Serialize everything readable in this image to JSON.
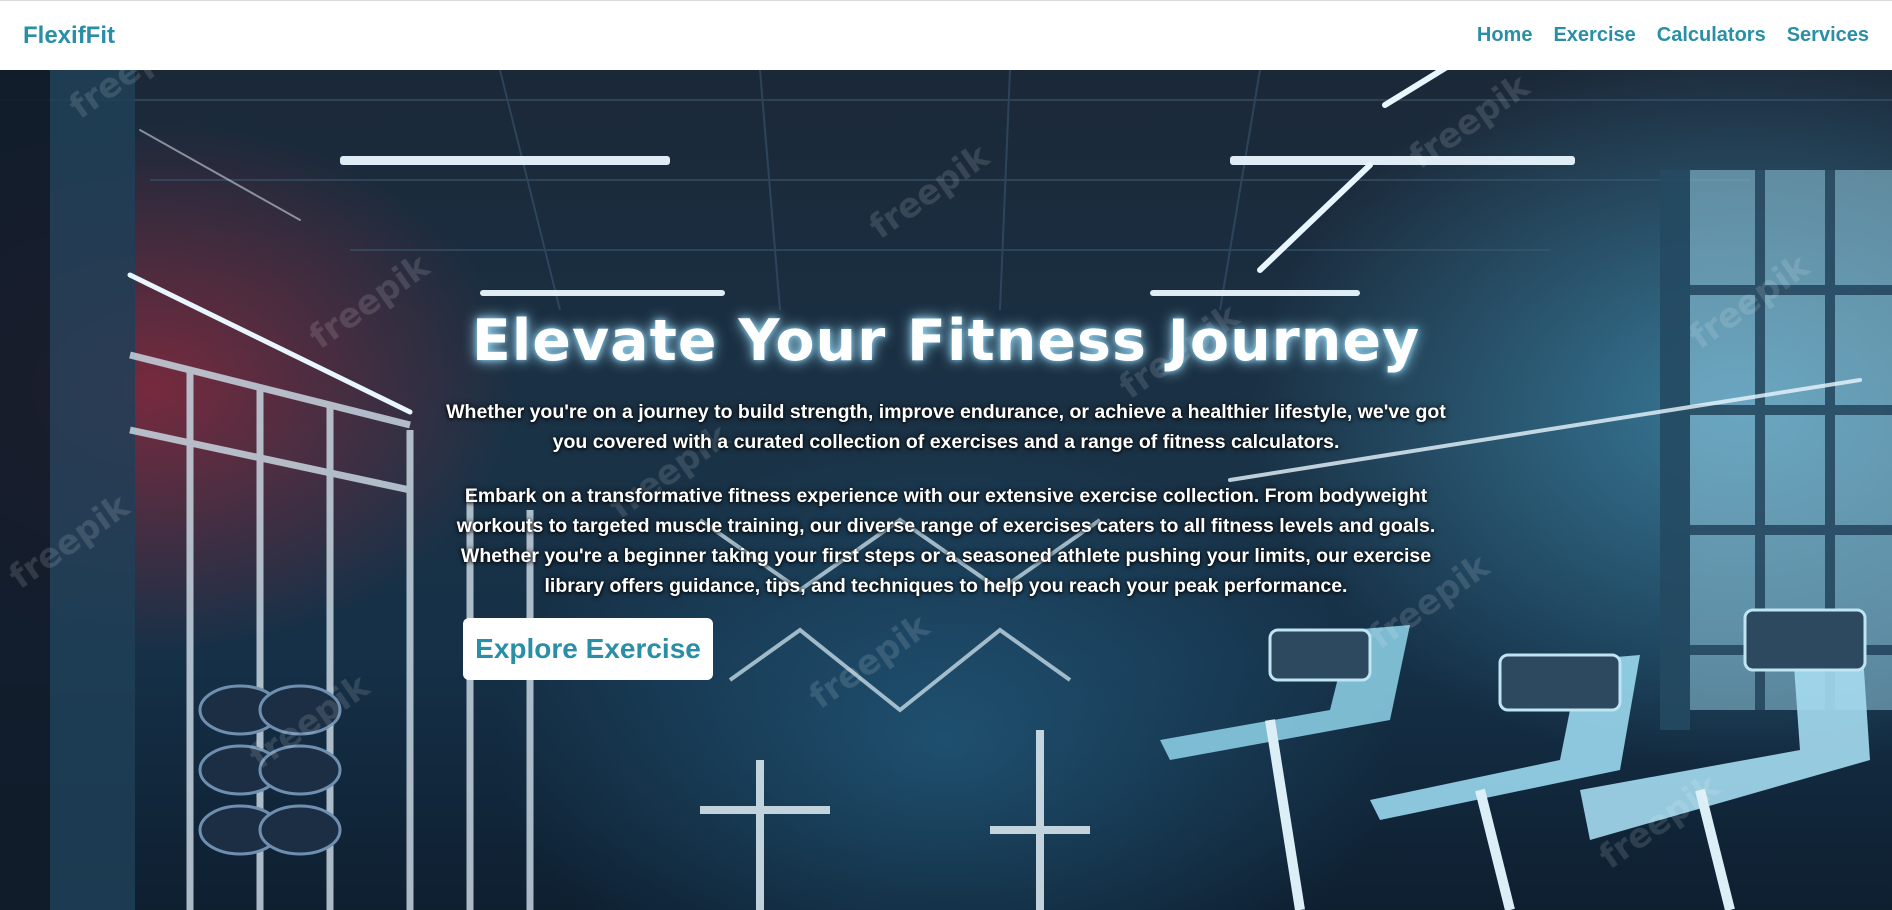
{
  "navbar": {
    "brand": "FlexifFit",
    "links": [
      "Home",
      "Exercise",
      "Calculators",
      "Services"
    ]
  },
  "hero": {
    "title": "Elevate Your Fitness Journey",
    "paragraph_1": "Whether you're on a journey to build strength, improve endurance, or achieve a healthier lifestyle, we've got you covered with a curated collection of exercises and a range of fitness calculators.",
    "paragraph_2": "Embark on a transformative fitness experience with our extensive exercise collection. From bodyweight workouts to targeted muscle training, our diverse range of exercises caters to all fitness levels and goals. Whether you're a beginner taking your first steps or a seasoned athlete pushing your limits, our exercise library offers guidance, tips, and techniques to help you reach your peak performance.",
    "cta_label": "Explore Exercise",
    "background_image": "gym-interior-with-treadmills",
    "watermark": "freepik"
  },
  "colors": {
    "accent": "#2a8fa6",
    "navbar_bg": "#ffffff",
    "hero_text": "#ffffff",
    "cta_bg": "#ffffff"
  }
}
